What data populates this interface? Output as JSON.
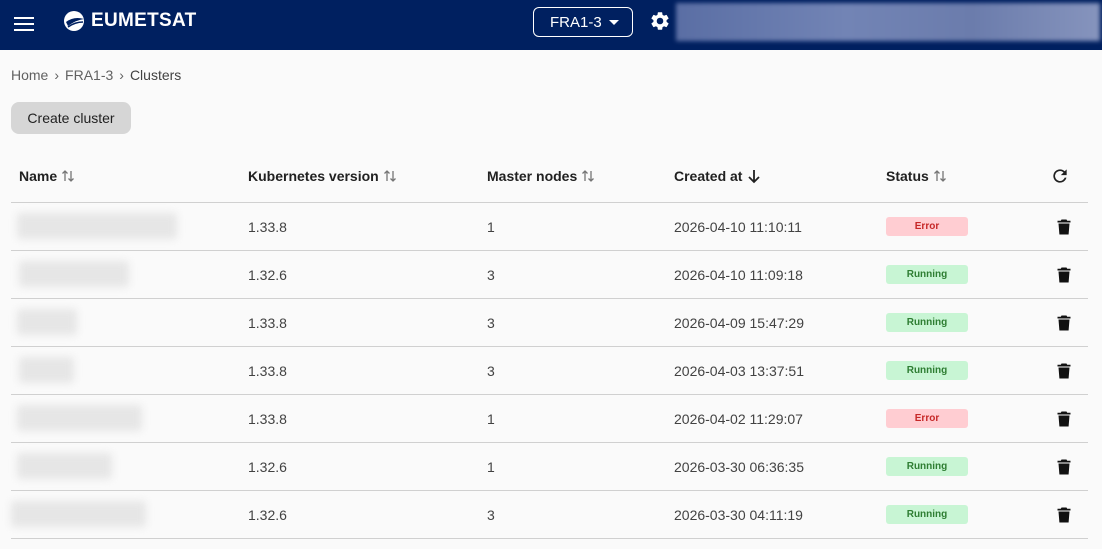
{
  "header": {
    "brand": "EUMETSAT",
    "region": "FRA1-3",
    "colors": {
      "bar": "#002060"
    }
  },
  "breadcrumb": [
    "Home",
    "FRA1-3",
    "Clusters"
  ],
  "actions": {
    "create_label": "Create cluster"
  },
  "table": {
    "columns": [
      "Name",
      "Kubernetes version",
      "Master nodes",
      "Created at",
      "Status"
    ],
    "sorted_column": "Created at",
    "rows": [
      {
        "version": "1.33.8",
        "master_nodes": "1",
        "created_at": "2026-04-10 11:10:11",
        "status": "Error"
      },
      {
        "version": "1.32.6",
        "master_nodes": "3",
        "created_at": "2026-04-10 11:09:18",
        "status": "Running"
      },
      {
        "version": "1.33.8",
        "master_nodes": "3",
        "created_at": "2026-04-09 15:47:29",
        "status": "Running"
      },
      {
        "version": "1.33.8",
        "master_nodes": "3",
        "created_at": "2026-04-03 13:37:51",
        "status": "Running"
      },
      {
        "version": "1.33.8",
        "master_nodes": "1",
        "created_at": "2026-04-02 11:29:07",
        "status": "Error"
      },
      {
        "version": "1.32.6",
        "master_nodes": "1",
        "created_at": "2026-03-30 06:36:35",
        "status": "Running"
      },
      {
        "version": "1.32.6",
        "master_nodes": "3",
        "created_at": "2026-03-30 04:11:19",
        "status": "Running"
      }
    ]
  },
  "icons": {
    "menu": "menu-icon",
    "settings": "gear-icon",
    "refresh": "refresh-icon",
    "delete": "trash-icon",
    "sort": "sort-icon"
  }
}
